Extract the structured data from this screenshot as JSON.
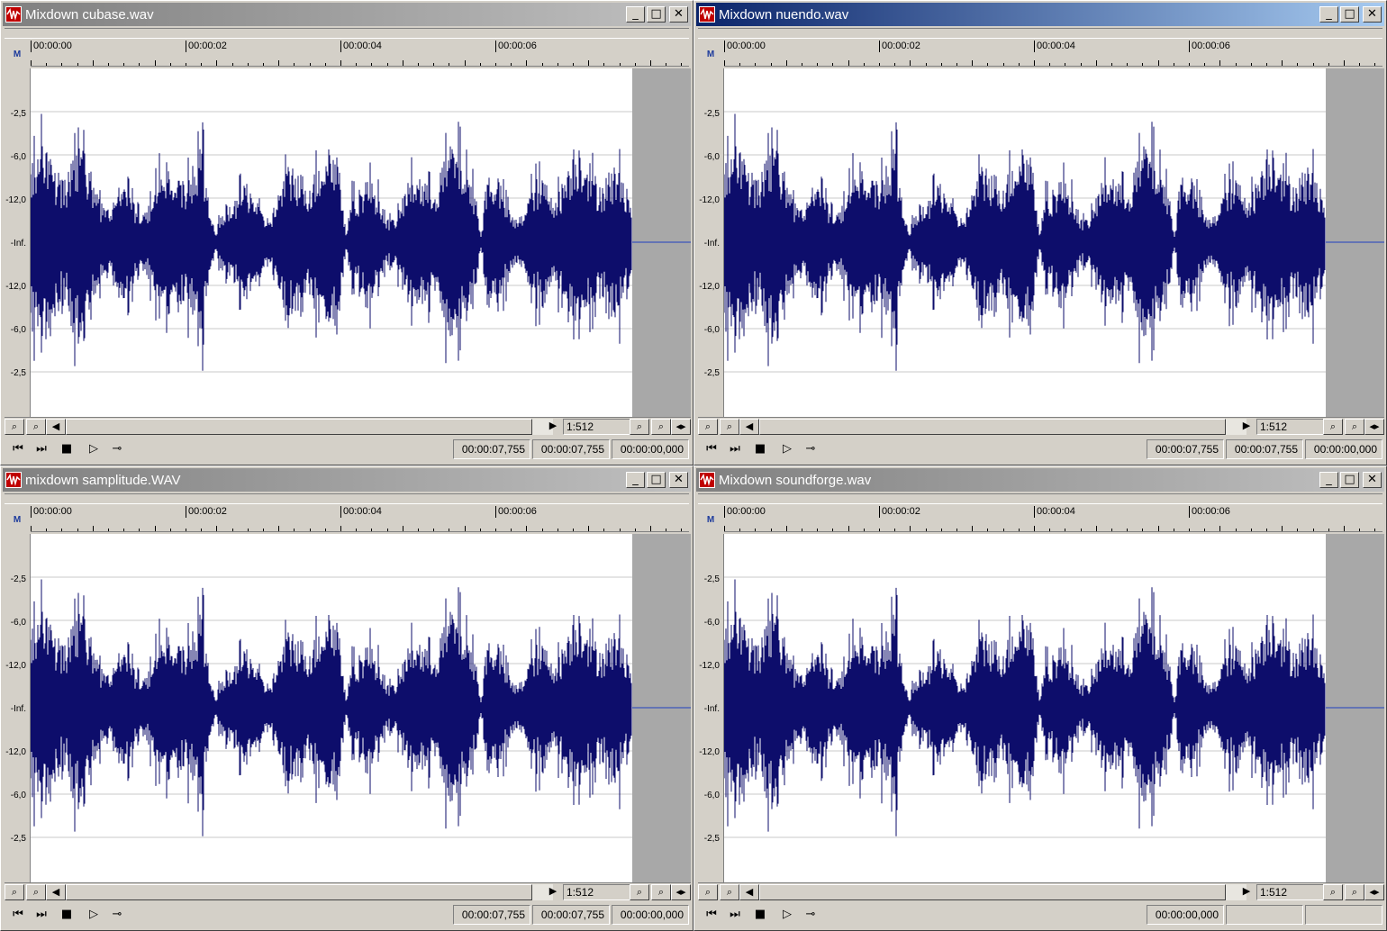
{
  "colors": {
    "waveform": "#0d0d6b",
    "active_title": "#0a246a",
    "inactive_title": "#808080"
  },
  "ruler_labels": [
    "00:00:00",
    "00:00:02",
    "00:00:04",
    "00:00:06"
  ],
  "db_labels": [
    "-2,5",
    "-6,0",
    "-12,0",
    "-Inf.",
    "-12,0",
    "-6,0",
    "-2,5"
  ],
  "windows": [
    {
      "title": "Mixdown cubase.wav",
      "active": false,
      "zoom": "1:512",
      "selection_start": "00:00:07,755",
      "selection_end": "00:00:07,755",
      "selection_length": "00:00:00,000"
    },
    {
      "title": "Mixdown nuendo.wav",
      "active": true,
      "zoom": "1:512",
      "selection_start": "00:00:07,755",
      "selection_end": "00:00:07,755",
      "selection_length": "00:00:00,000"
    },
    {
      "title": "mixdown samplitude.WAV",
      "active": false,
      "zoom": "1:512",
      "selection_start": "00:00:07,755",
      "selection_end": "00:00:07,755",
      "selection_length": "00:00:00,000"
    },
    {
      "title": "Mixdown soundforge.wav",
      "active": false,
      "zoom": "1:512",
      "selection_start": "00:00:00,000",
      "selection_end": "",
      "selection_length": ""
    }
  ]
}
